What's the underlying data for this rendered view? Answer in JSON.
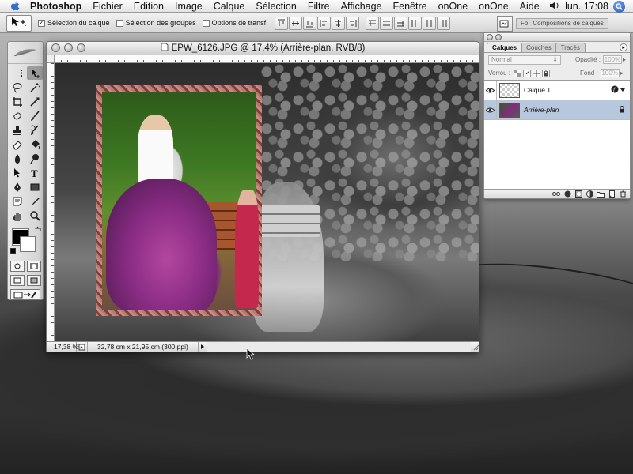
{
  "menubar": {
    "app_name": "Photoshop",
    "items": [
      "Fichier",
      "Edition",
      "Image",
      "Calque",
      "Sélection",
      "Filtre",
      "Affichage",
      "Fenêtre",
      "onOne",
      "onOne",
      "Aide"
    ],
    "clock": "lun. 17:08"
  },
  "options_bar": {
    "auto_select_layer": {
      "label": "Sélection du calque",
      "checked": true
    },
    "auto_select_groups": {
      "label": "Sélection des groupes",
      "checked": false
    },
    "transform_options": {
      "label": "Options de transf.",
      "checked": false
    },
    "palette_well_tabs": [
      "Fo",
      "Compositions de calques"
    ]
  },
  "document": {
    "title": "EPW_6126.JPG @ 17,4% (Arrière-plan, RVB/8)",
    "zoom": "17,38 %",
    "doc_info": "32,78 cm x 21,95 cm (300 ppi)"
  },
  "layers_panel": {
    "tabs": [
      "Calques",
      "Couches",
      "Tracés"
    ],
    "blend_mode": "Normal",
    "opacity_label": "Opacité :",
    "opacity_value": "100%",
    "lock_label": "Verrou :",
    "fill_label": "Fond :",
    "fill_value": "100%",
    "layers": [
      {
        "name": "Calque 1",
        "visible": true,
        "selected": false,
        "italic": false
      },
      {
        "name": "Arrière-plan",
        "visible": true,
        "selected": true,
        "italic": true,
        "locked": true
      }
    ]
  },
  "colors": {
    "foreground": "#000000",
    "background": "#ffffff",
    "selection_highlight": "#b6c7de"
  }
}
